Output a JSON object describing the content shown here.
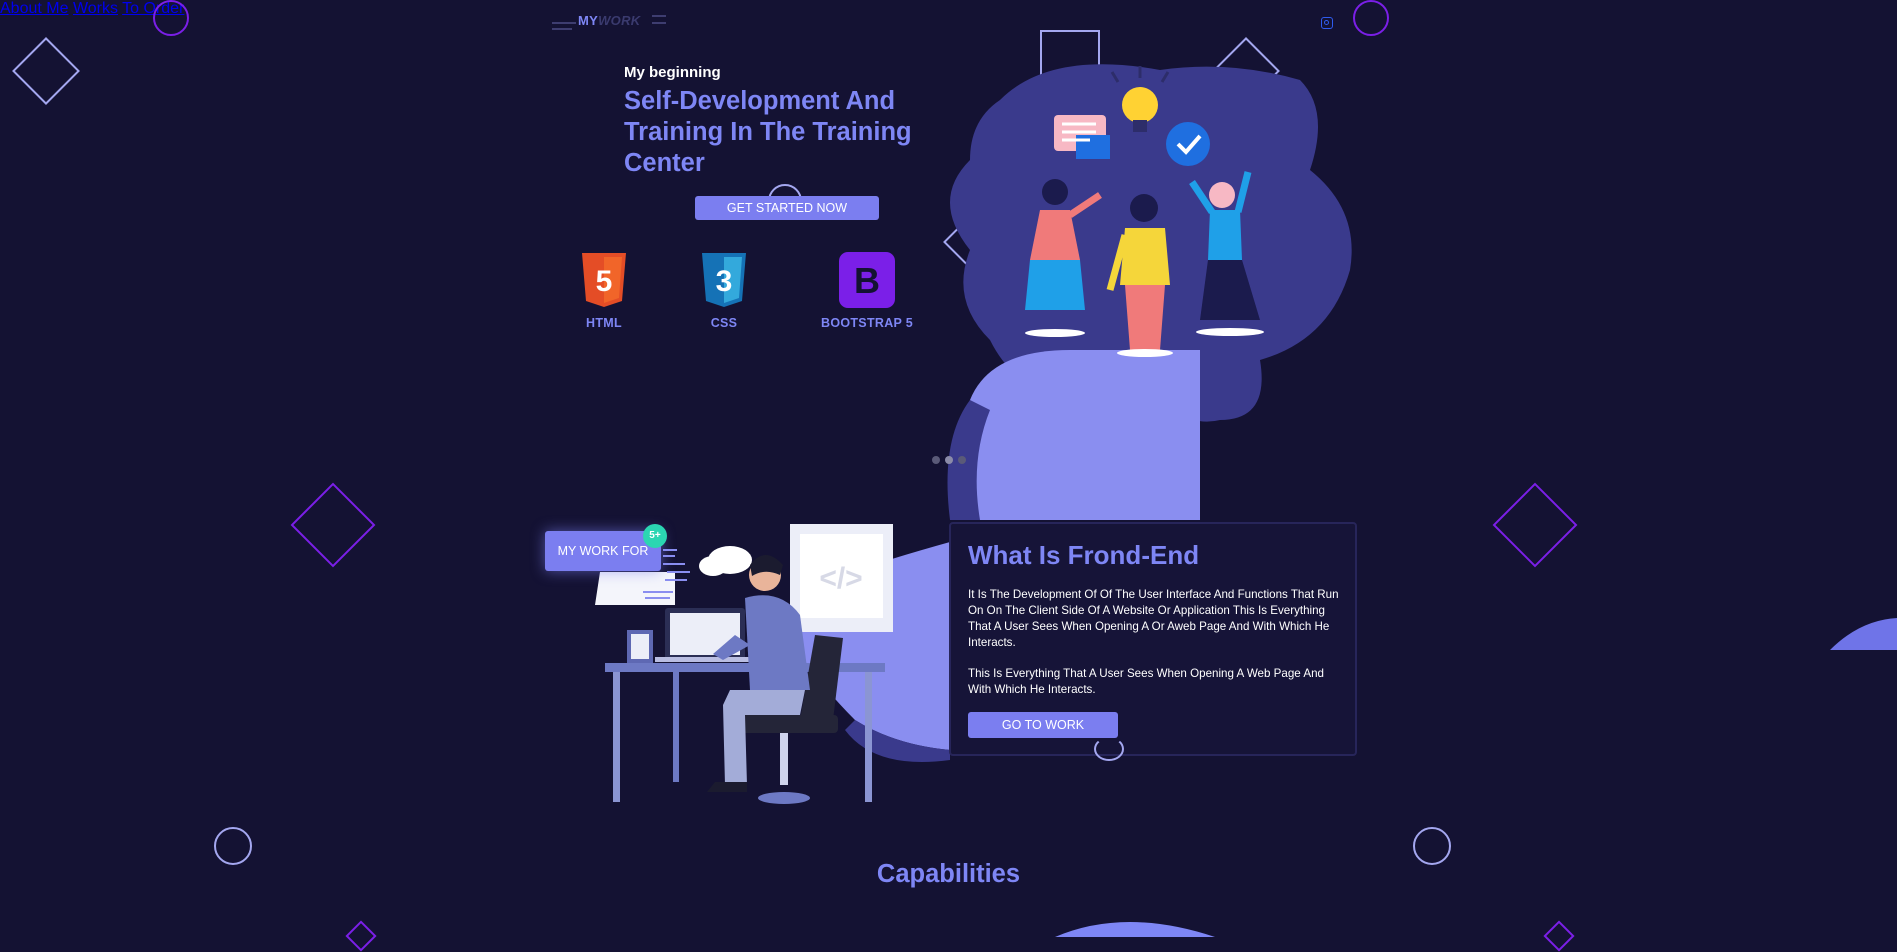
{
  "brand": {
    "logo_part1": "MY",
    "logo_part2": "WORK"
  },
  "nav": {
    "items": [
      "About Me",
      "Works",
      "To Order"
    ],
    "icon": "instagram-icon"
  },
  "hero": {
    "kicker": "My beginning",
    "title": "Self-Development And Training In The Training Center",
    "cta": "GET STARTED NOW",
    "tech": [
      {
        "label": "HTML",
        "digit": "5",
        "icon": "html5-icon"
      },
      {
        "label": "CSS",
        "digit": "3",
        "icon": "css3-icon"
      },
      {
        "label": "BOOTSTRAP 5",
        "digit": "B",
        "icon": "bootstrap-icon"
      }
    ],
    "carousel": {
      "slides": 3,
      "active": 2
    }
  },
  "work": {
    "badge_label": "MY WORK FOR",
    "badge_count": "5+",
    "card_title": "What Is Frond-End",
    "paragraph_1": "It Is The Development Of Of The User Interface And Functions That Run On On The Client Side Of A Website Or Application This Is Everything That A User Sees When Opening A Or Aweb Page And With Which He Interacts.",
    "paragraph_2": "This Is Everything That A User Sees When Opening A Web Page And With Which He Interacts.",
    "cta": "GO TO WORK",
    "code_symbol": "</>"
  },
  "capabilities": {
    "title": "Capabilities"
  },
  "colors": {
    "background": "#141233",
    "accent": "#7e86f5",
    "button": "#7b7ef0",
    "nav_link": "#2f5cf0",
    "purple_outline": "#7b1fe8",
    "lavender_outline": "#a4a7f0",
    "badge_teal": "#2bd6b2"
  }
}
